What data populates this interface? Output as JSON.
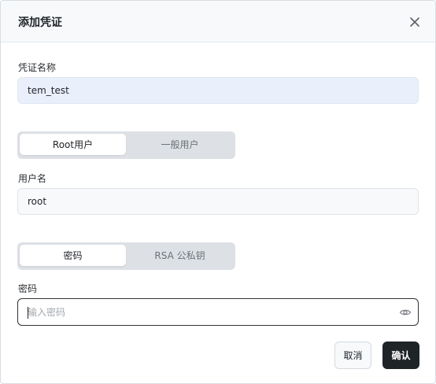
{
  "dialog": {
    "title": "添加凭证",
    "close_icon": "close-icon"
  },
  "credential": {
    "name_label": "凭证名称",
    "name_value": "tem_test"
  },
  "user_type": {
    "options": [
      "Root用户",
      "一般用户"
    ],
    "selected": "Root用户"
  },
  "username": {
    "label": "用户名",
    "value": "root"
  },
  "auth_type": {
    "options": [
      "密码",
      "RSA 公私钥"
    ],
    "selected": "密码"
  },
  "password": {
    "label": "密码",
    "placeholder": "输入密码",
    "value": "",
    "toggle_icon": "eye-icon"
  },
  "actions": {
    "cancel_label": "取消",
    "confirm_label": "确认"
  }
}
